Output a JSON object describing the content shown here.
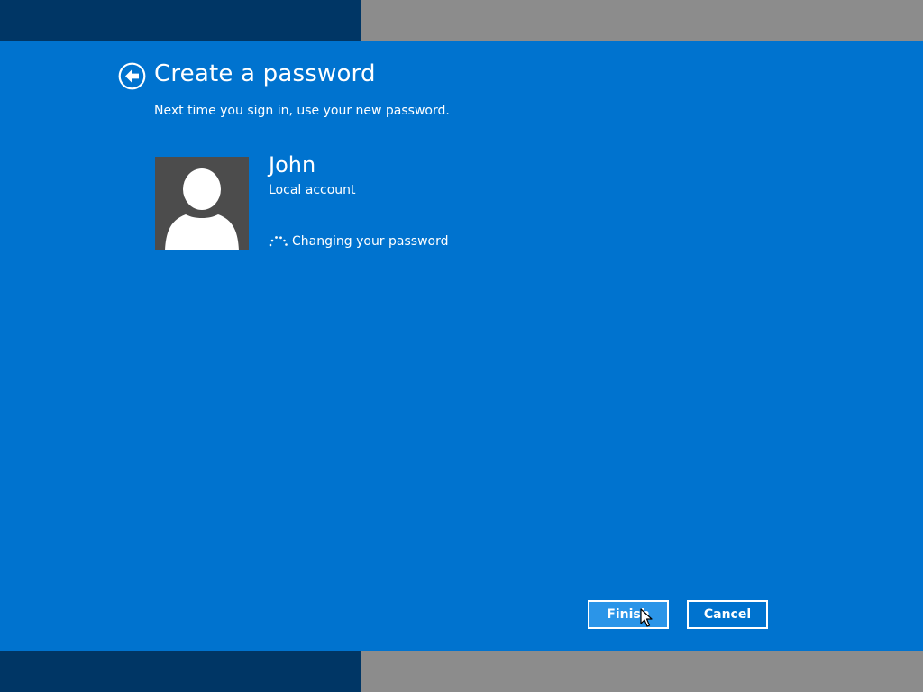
{
  "header": {
    "title": "Create a password",
    "subtitle": "Next time you sign in, use your new password."
  },
  "user": {
    "name": "John",
    "account_type": "Local account"
  },
  "status": {
    "text": "Changing your password"
  },
  "buttons": {
    "finish_label": "Finish",
    "cancel_label": "Cancel"
  },
  "colors": {
    "panel": "#0073cf",
    "band_dark": "#003665",
    "band_gray": "#8c8c8c",
    "avatar_bg": "#4c4c4c",
    "finish_bg": "#2b95e8",
    "text": "#ffffff"
  },
  "icons": {
    "back": "back-arrow-icon",
    "avatar": "user-silhouette-icon",
    "spinner": "loading-spinner-icon",
    "cursor": "mouse-cursor-icon"
  }
}
